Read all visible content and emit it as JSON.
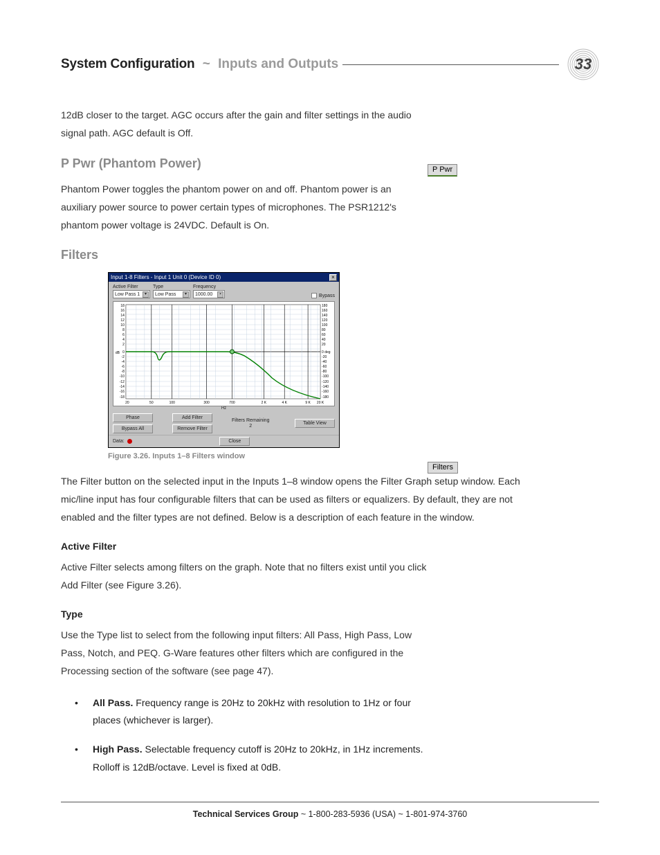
{
  "header": {
    "title_bold": "System Configuration",
    "title_sep": "~",
    "title_sub": "Inputs and Outputs",
    "page_number": "33"
  },
  "intro_para": "12dB closer to the target. AGC occurs after the gain and filter settings in the audio signal path. AGC default is Off.",
  "ppwr": {
    "heading": "P Pwr (Phantom Power)",
    "para": "Phantom Power toggles the phantom power on and off. Phantom power is an auxiliary power source to power certain types of microphones. The PSR1212's phantom power voltage is 24VDC. Default is On.",
    "btn_label": "P Pwr"
  },
  "filters": {
    "heading": "Filters",
    "caption": "Figure 3.26. Inputs 1–8 Filters window",
    "btn_label": "Filters",
    "para": "The Filter button on the selected input in the Inputs 1–8 window opens the Filter Graph setup window. Each mic/line input has four configurable filters that can be used as filters or equalizers. By default, they are not enabled and the filter types are not defined. Below is a description of each feature in the window.",
    "window": {
      "title": "Input 1-8 Filters - Input 1  Unit 0 (Device ID 0)",
      "active_filter_label": "Active Filter",
      "active_filter_value": "Low Pass 1",
      "type_label": "Type",
      "type_value": "Low Pass",
      "freq_label": "Frequency",
      "freq_value": "1000.00",
      "bypass_label": "Bypass",
      "db_label": "dB",
      "deg_label": "0 deg",
      "hz_label": "Hz",
      "btn_phase": "Phase",
      "btn_bypass_all": "Bypass All",
      "btn_add": "Add Filter",
      "btn_remove": "Remove Filter",
      "remain_label": "Filters Remaining",
      "remain_value": "2",
      "btn_table": "Table View",
      "data_label": "Data:",
      "btn_close": "Close"
    },
    "active_filter": {
      "heading": "Active Filter",
      "para": "Active Filter selects among filters on the graph. Note that no filters exist until you click Add Filter (see Figure 3.26)."
    },
    "type_section": {
      "heading": "Type",
      "para": "Use the Type list to select from the following input filters: All Pass, High Pass, Low Pass, Notch, and PEQ. G-Ware features other filters which are configured in the Processing section of the software (see page 47).",
      "bullets": [
        {
          "label": "All Pass.",
          "text": " Frequency range is 20Hz to 20kHz with resolution to 1Hz or four places (whichever is larger)."
        },
        {
          "label": "High Pass.",
          "text": " Selectable frequency cutoff is 20Hz to 20kHz, in 1Hz increments. Rolloff is 12dB/octave. Level is fixed at 0dB."
        }
      ]
    }
  },
  "chart_data": {
    "type": "line",
    "title": "Low Pass Filter Response",
    "xlabel": "Hz",
    "ylabel_left": "dB",
    "ylabel_right": "deg",
    "x_ticks": [
      20,
      50,
      100,
      300,
      700,
      2000,
      4000,
      9000,
      20000
    ],
    "y_ticks_left": [
      -18,
      -16,
      -14,
      -12,
      -10,
      -8,
      -6,
      -4,
      -2,
      0,
      2,
      4,
      6,
      8,
      10,
      12,
      14,
      16,
      18
    ],
    "y_ticks_right": [
      -180,
      -160,
      -140,
      -120,
      -100,
      -80,
      -60,
      -40,
      -20,
      0,
      20,
      40,
      60,
      80,
      100,
      120,
      140,
      160,
      180
    ],
    "xlim": [
      20,
      20000
    ],
    "ylim_left": [
      -18,
      18
    ],
    "ylim_right": [
      -180,
      180
    ],
    "series": [
      {
        "name": "Low Pass 1",
        "color": "#008000",
        "x": [
          20,
          50,
          60,
          70,
          90,
          150,
          300,
          700,
          1000,
          1400,
          2000,
          3000,
          5000,
          9000,
          20000
        ],
        "y": [
          0,
          0,
          -1,
          -3,
          -1,
          0,
          0,
          0,
          0,
          -1,
          -3,
          -6,
          -10,
          -15,
          -18
        ]
      }
    ],
    "marker": {
      "x": 700,
      "y": 0
    }
  },
  "footer": {
    "label": "Technical Services Group",
    "rest": " ~ 1-800-283-5936 (USA) ~ 1-801-974-3760"
  }
}
